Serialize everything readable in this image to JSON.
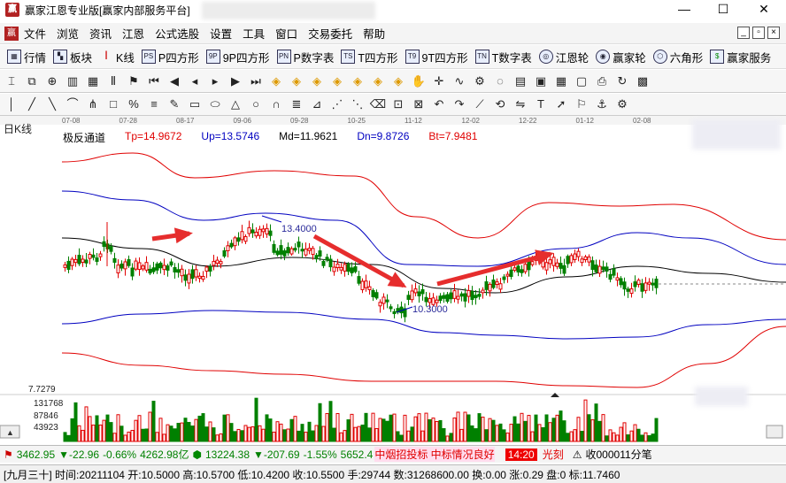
{
  "window": {
    "title": "赢家江恩专业版[赢家内部服务平台]",
    "minimize": "—",
    "maximize": "☐",
    "close": "✕"
  },
  "menu": [
    "文件",
    "浏览",
    "资讯",
    "江恩",
    "公式选股",
    "设置",
    "工具",
    "窗口",
    "交易委托",
    "帮助"
  ],
  "toolbar1": [
    {
      "label": "行情",
      "icon": "grid-icon"
    },
    {
      "label": "板块",
      "icon": "blocks-icon"
    },
    {
      "label": "K线",
      "icon": "candlestick-icon"
    },
    {
      "label": "P四方形",
      "icon": "ps-icon",
      "tag": "PS"
    },
    {
      "label": "9P四方形",
      "icon": "9p-icon",
      "tag": "9P"
    },
    {
      "label": "P数字表",
      "icon": "pn-icon",
      "tag": "PN"
    },
    {
      "label": "T四方形",
      "icon": "ts-icon",
      "tag": "TS"
    },
    {
      "label": "9T四方形",
      "icon": "t9-icon",
      "tag": "T9"
    },
    {
      "label": "T数字表",
      "icon": "tn-icon",
      "tag": "TN"
    },
    {
      "label": "江恩轮",
      "icon": "wheel-icon"
    },
    {
      "label": "赢家轮",
      "icon": "winner-wheel-icon"
    },
    {
      "label": "六角形",
      "icon": "hexagon-icon"
    },
    {
      "label": "赢家服务",
      "icon": "service-icon"
    }
  ],
  "toolbar2_icons": [
    "cursor-icon",
    "copy-icon",
    "zoom-icon",
    "bar-chart-icon",
    "grid-icon",
    "text-icon",
    "flag-icon",
    "first-icon",
    "prev-icon",
    "left-icon",
    "right-icon",
    "next-icon",
    "last-icon",
    "diamond-icon",
    "diamond-icon",
    "diamond-icon",
    "diamond-icon",
    "diamond-icon",
    "diamond-icon",
    "diamond-icon",
    "hand-icon",
    "crosshair-icon",
    "wave-icon",
    "gann-icon",
    "bubble-icon",
    "page-icon",
    "calc-icon",
    "table-icon",
    "save-icon",
    "print-icon",
    "refresh-icon",
    "chip-icon"
  ],
  "toolbar3_icons": [
    "line-icon",
    "ray-icon",
    "trend-icon",
    "arc-icon",
    "fan-icon",
    "square-icon",
    "percent-icon",
    "channel-icon",
    "pen-icon",
    "box-icon",
    "ellipse-icon",
    "triangle-icon",
    "circle-icon",
    "cycle-icon",
    "fib-icon",
    "gann-fan-icon",
    "speed-icon",
    "pitch-icon",
    "eraser-icon",
    "lock-icon",
    "delete-icon",
    "undo-icon",
    "redo-icon",
    "tilt-icon",
    "rotate-icon",
    "mirror-icon",
    "text-tool-icon",
    "arrow-tool-icon",
    "flag-tool-icon",
    "anchor-icon",
    "settings-icon"
  ],
  "chart": {
    "period_label": "日K线",
    "indicator_name": "极反通道",
    "indicators": [
      {
        "label": "Tp=14.9672",
        "color": "#e00000"
      },
      {
        "label": "Up=13.5746",
        "color": "#0000c0"
      },
      {
        "label": "Md=11.9621",
        "color": "#000000"
      },
      {
        "label": "Dn=9.8726",
        "color": "#0000c0"
      },
      {
        "label": "Bt=7.9481",
        "color": "#e00000"
      }
    ],
    "date_ticks": [
      "07-08",
      "07-28",
      "08-17",
      "09-06",
      "09-28",
      "10-25",
      "11-12",
      "12-02",
      "12-22",
      "01-12",
      "02-08"
    ],
    "price_high_label": "13.4000",
    "price_low_label": "10.3000",
    "y_left_label": "7.7279",
    "volume_labels": [
      "131768",
      "87846",
      "43923"
    ],
    "x_labels_unit": "亿"
  },
  "status1": {
    "sh_value": "3462.95",
    "sh_change": "▼-22.96",
    "sh_pct": "-0.66%",
    "sh_amount": "4262.98亿",
    "sz_value": "13224.38",
    "sz_change": "▼-207.69",
    "sz_pct": "-1.55%",
    "sz_amount": "5652.4",
    "ticker_news": "中烟招投标 中标情况良好",
    "time": "14:20",
    "time_label": "光刻",
    "stock": "收000011分笔"
  },
  "status2": {
    "text": "[九月三十] 时间:20211104 开:10.5000 高:10.5700 低:10.4200 收:10.5500 手:29744 数:31268600.00 换:0.00 涨:0.29 盘:0 标:11.7460"
  },
  "colors": {
    "up": "#e00000",
    "down": "#008000",
    "band_outer": "#e00000",
    "band_inner": "#0000c0",
    "band_mid": "#000000",
    "arrow": "#e62d2d"
  },
  "chart_data": {
    "type": "candlestick",
    "title": "",
    "series": [
      {
        "name": "Tp",
        "values": [
          14.97
        ]
      },
      {
        "name": "Up",
        "values": [
          13.57
        ]
      },
      {
        "name": "Md",
        "values": [
          11.96
        ]
      },
      {
        "name": "Dn",
        "values": [
          9.87
        ]
      },
      {
        "name": "Bt",
        "values": [
          7.95
        ]
      }
    ],
    "annotations": [
      "13.4000",
      "10.3000"
    ],
    "ylim": [
      7.7279,
      15.5
    ]
  }
}
